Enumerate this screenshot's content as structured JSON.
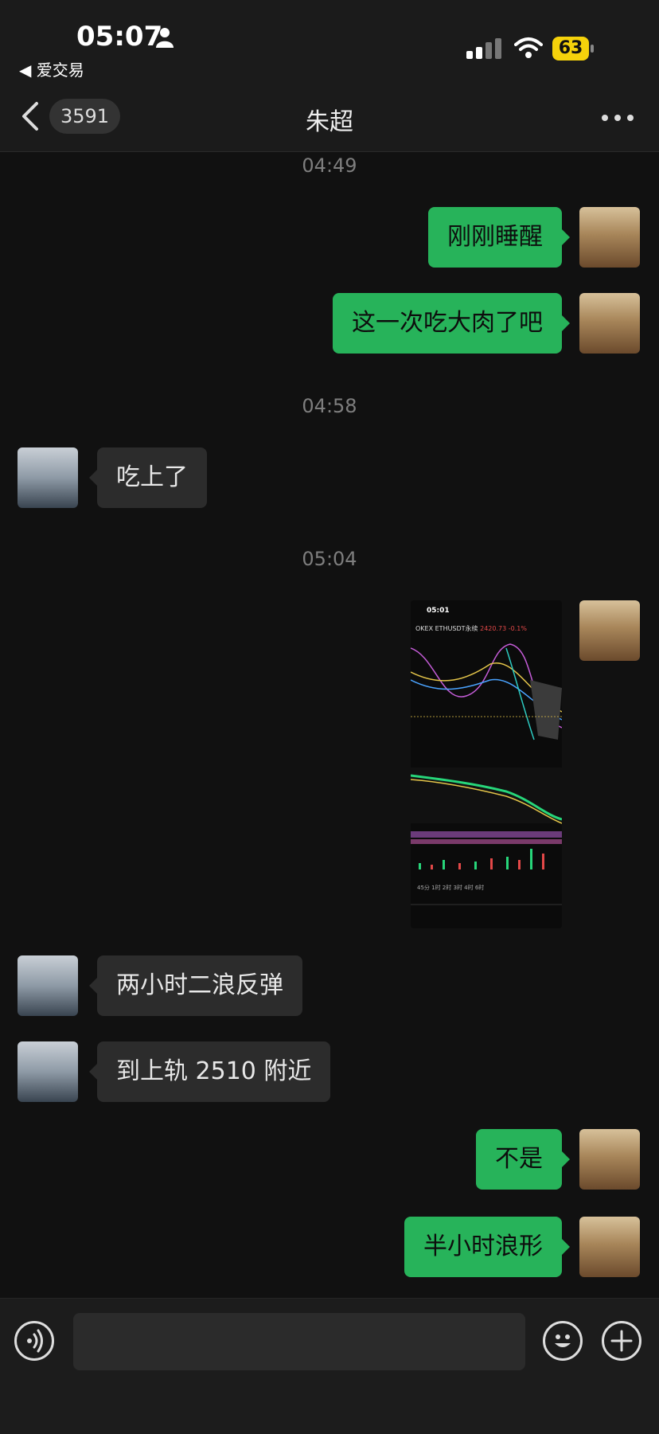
{
  "status_bar": {
    "time": "05:07",
    "back_app": "◀ 爱交易",
    "battery": "63"
  },
  "nav": {
    "unread_count": "3591",
    "title": "朱超"
  },
  "timestamps": [
    "04:49",
    "04:58",
    "05:04"
  ],
  "messages": [
    {
      "side": "out",
      "text": "刚刚睡醒"
    },
    {
      "side": "out",
      "text": "这一次吃大肉了吧"
    },
    {
      "side": "in",
      "text": "吃上了"
    },
    {
      "side": "out",
      "type": "image",
      "text": ""
    },
    {
      "side": "in",
      "text": "两小时二浪反弹"
    },
    {
      "side": "in",
      "text": "到上轨 2510 附近"
    },
    {
      "side": "out",
      "text": "不是"
    },
    {
      "side": "out",
      "text": "半小时浪形"
    }
  ],
  "image_message": {
    "time": "05:01",
    "title": "OKEX ETHUSDT永续",
    "price": "2420.73",
    "change": "-0.1%",
    "tabs": "45分  1时  2时  3时  4时  6时"
  },
  "colors": {
    "outgoing_bubble": "#27b35a",
    "incoming_bubble": "#2c2c2c",
    "background": "#111111",
    "battery": "#f5d20b"
  },
  "input": {
    "placeholder": ""
  }
}
